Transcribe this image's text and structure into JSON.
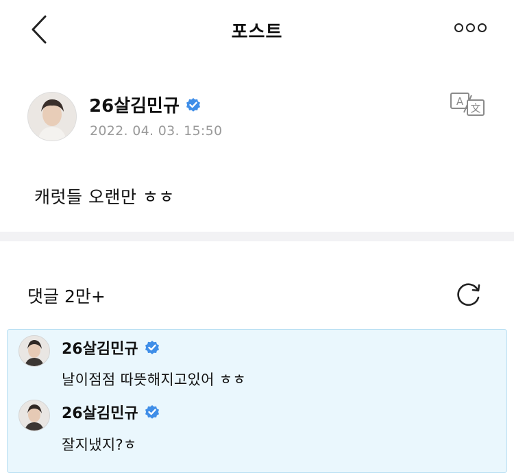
{
  "header": {
    "title": "포스트"
  },
  "icons": {
    "back": "chevron-left-icon",
    "more": "more-dots-icon",
    "translate": "translate-icon",
    "refresh": "refresh-icon",
    "verified": "verified-badge-icon"
  },
  "post": {
    "author": "26살김민규",
    "date": "2022. 04. 03. 15:50",
    "text": "캐럿들 오랜만 ㅎㅎ"
  },
  "comments": {
    "header": "댓글 2만+",
    "items": [
      {
        "author": "26살김민규",
        "text": "날이점점 따뜻해지고있어 ㅎㅎ"
      },
      {
        "author": "26살김민규",
        "text": "잘지냈지?ㅎ"
      }
    ]
  },
  "colors": {
    "verified": "#3f8ee8",
    "thread_bg": "#eaf7fd",
    "thread_border": "#b8dff2",
    "date": "#9a9a9a"
  }
}
